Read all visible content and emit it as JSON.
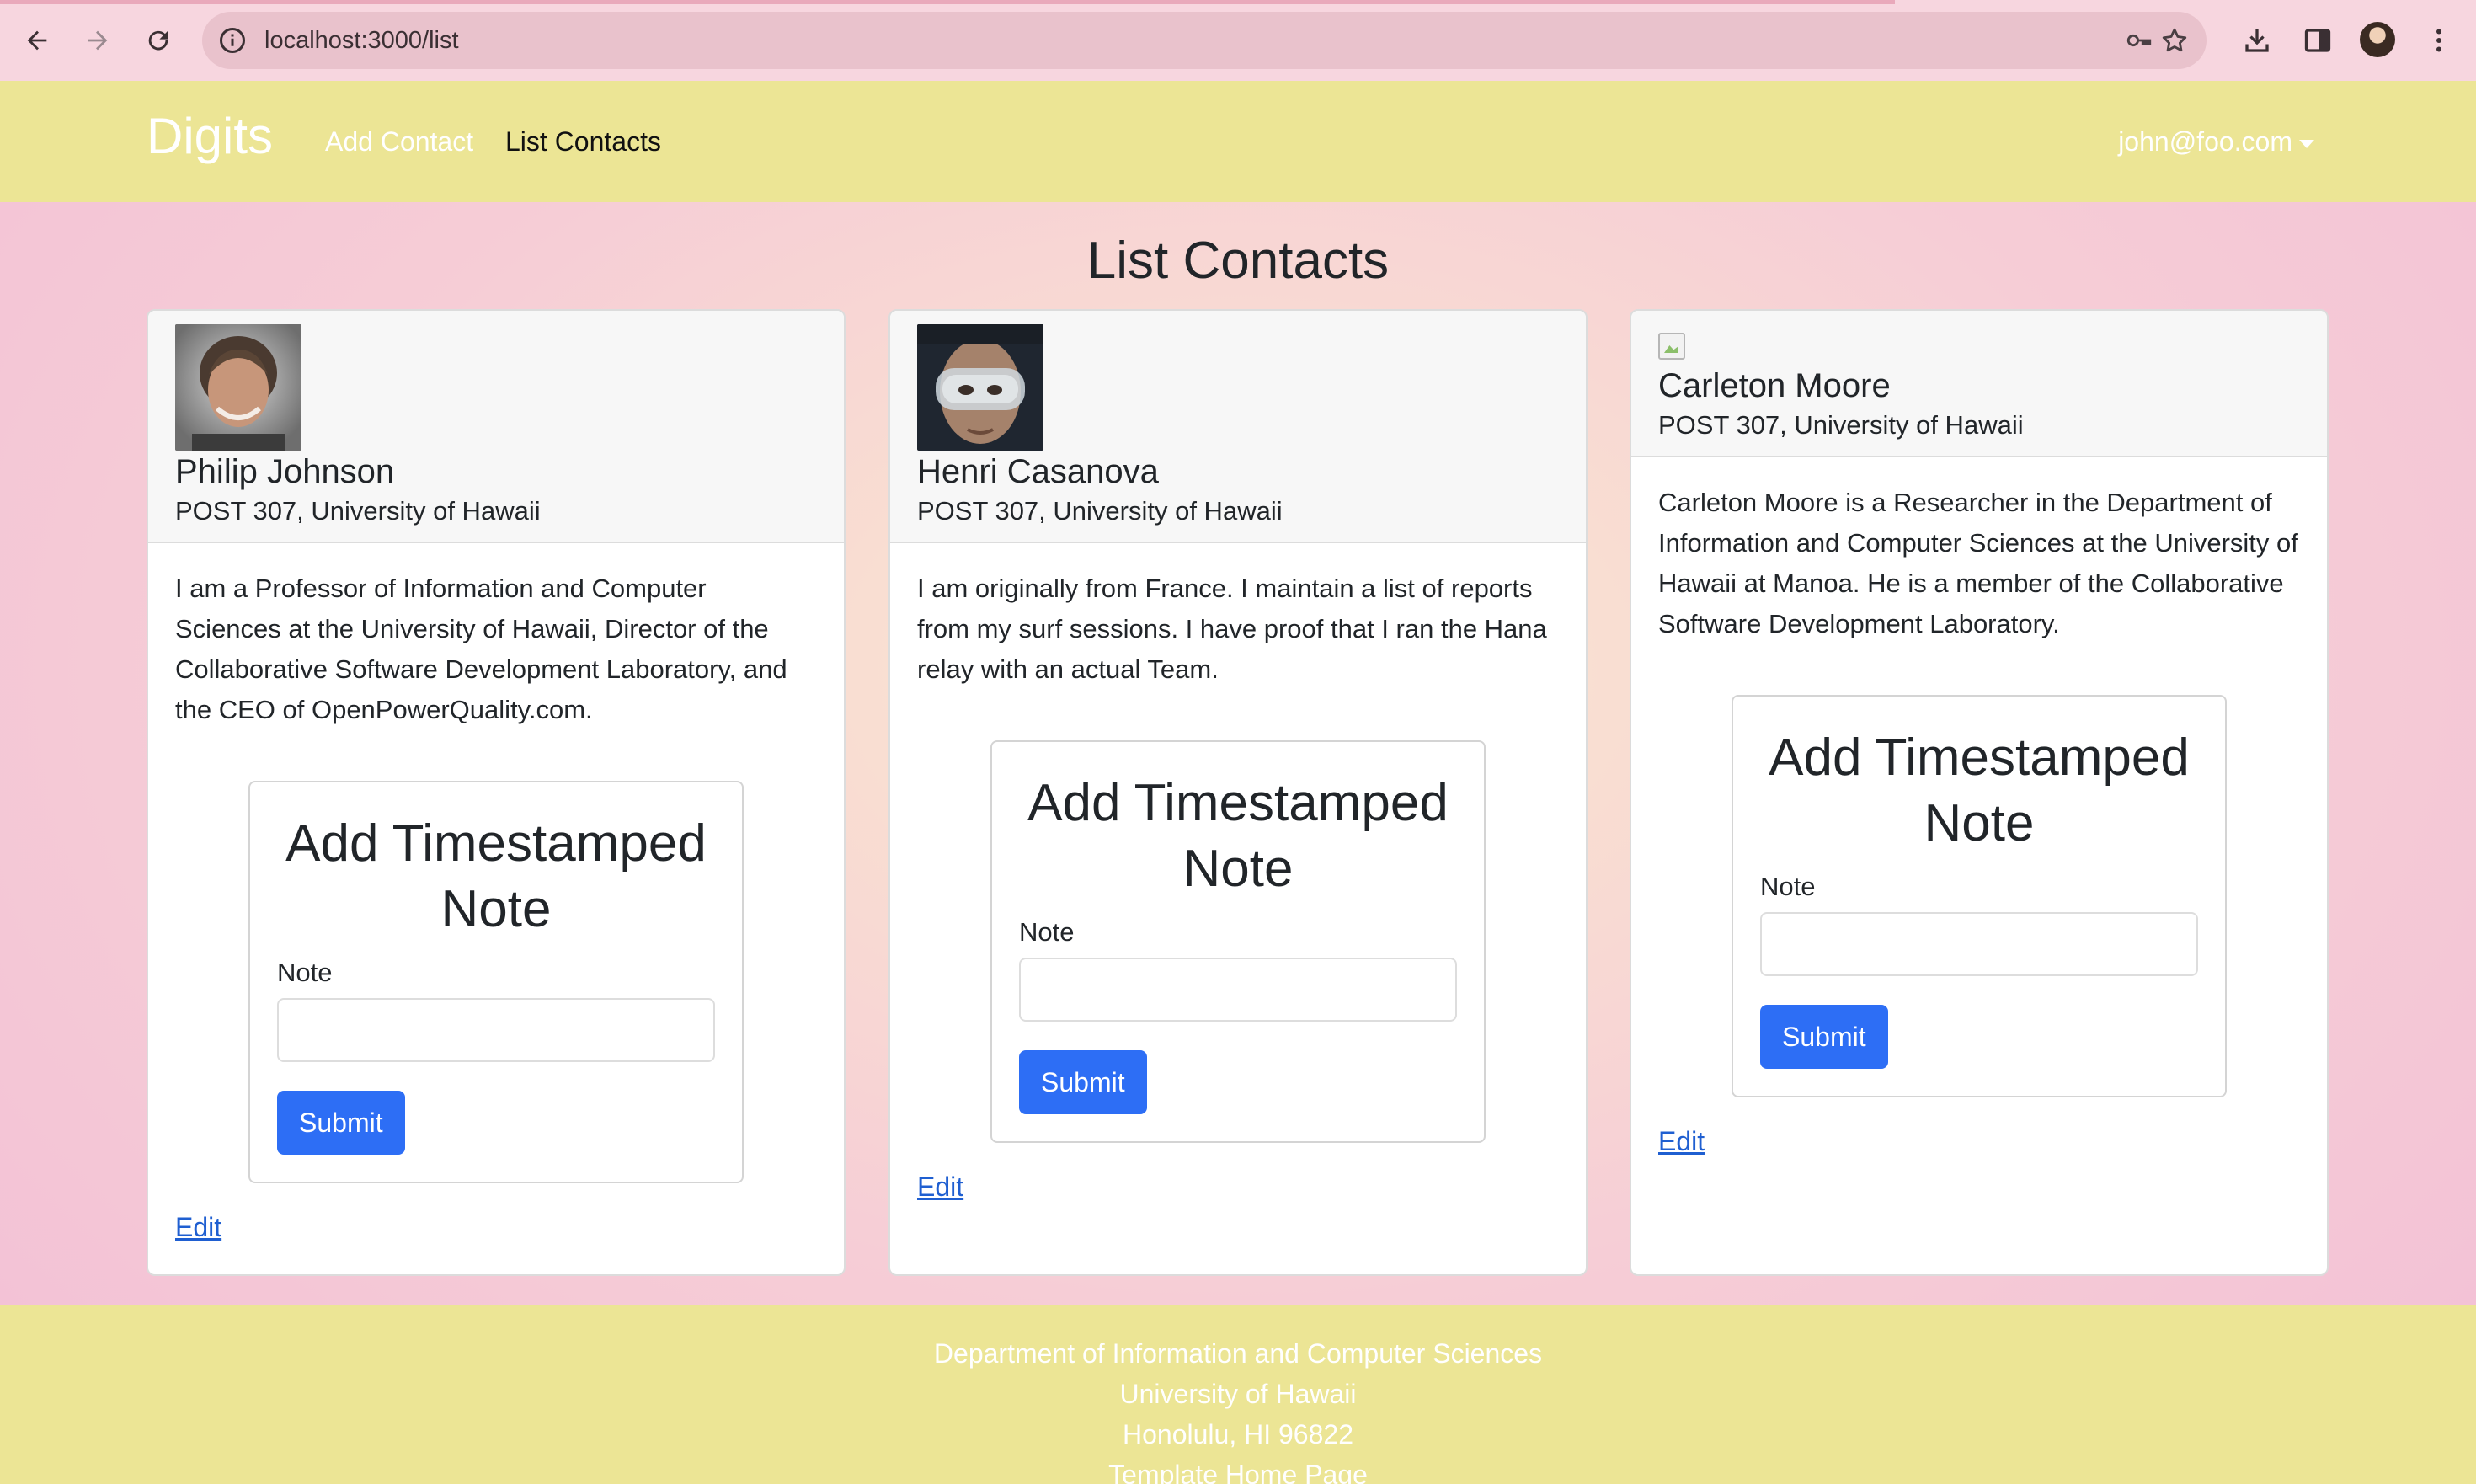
{
  "browser": {
    "url": "localhost:3000/list",
    "icons": [
      "back-arrow-icon",
      "forward-arrow-icon",
      "reload-icon",
      "site-info-icon",
      "key-icon",
      "star-icon",
      "download-icon",
      "sidepanel-icon",
      "profile-avatar",
      "menu-kebab-icon"
    ]
  },
  "navbar": {
    "brand": "Digits",
    "links": [
      "Add Contact",
      "List Contacts"
    ],
    "active": "List Contacts",
    "user": "john@foo.com",
    "background": "#ece595"
  },
  "page": {
    "title": "List Contacts"
  },
  "contacts": [
    {
      "name": "Philip Johnson",
      "address": "POST 307, University of Hawaii",
      "description": "I am a Professor of Information and Computer Sciences at the University of Hawaii, Director of the Collaborative Software Development Laboratory, and the CEO of OpenPowerQuality.com.",
      "has_photo": true
    },
    {
      "name": "Henri Casanova",
      "address": "POST 307, University of Hawaii",
      "description": "I am originally from France. I maintain a list of reports from my surf sessions. I have proof that I ran the Hana relay with an actual Team.",
      "has_photo": true
    },
    {
      "name": "Carleton Moore",
      "address": "POST 307, University of Hawaii",
      "description": "Carleton Moore is a Researcher in the Department of Information and Computer Sciences at the University of Hawaii at Manoa. He is a member of the Collaborative Software Development Laboratory.",
      "has_photo": false
    }
  ],
  "note_form": {
    "title": "Add Timestamped Note",
    "label": "Note",
    "value": "",
    "submit": "Submit"
  },
  "edit_label": "Edit",
  "submit_color": "#2d6ef5",
  "footer": {
    "lines": [
      "Department of Information and Computer Sciences",
      "University of Hawaii",
      "Honolulu, HI 96822"
    ],
    "link": "Template Home Page"
  }
}
